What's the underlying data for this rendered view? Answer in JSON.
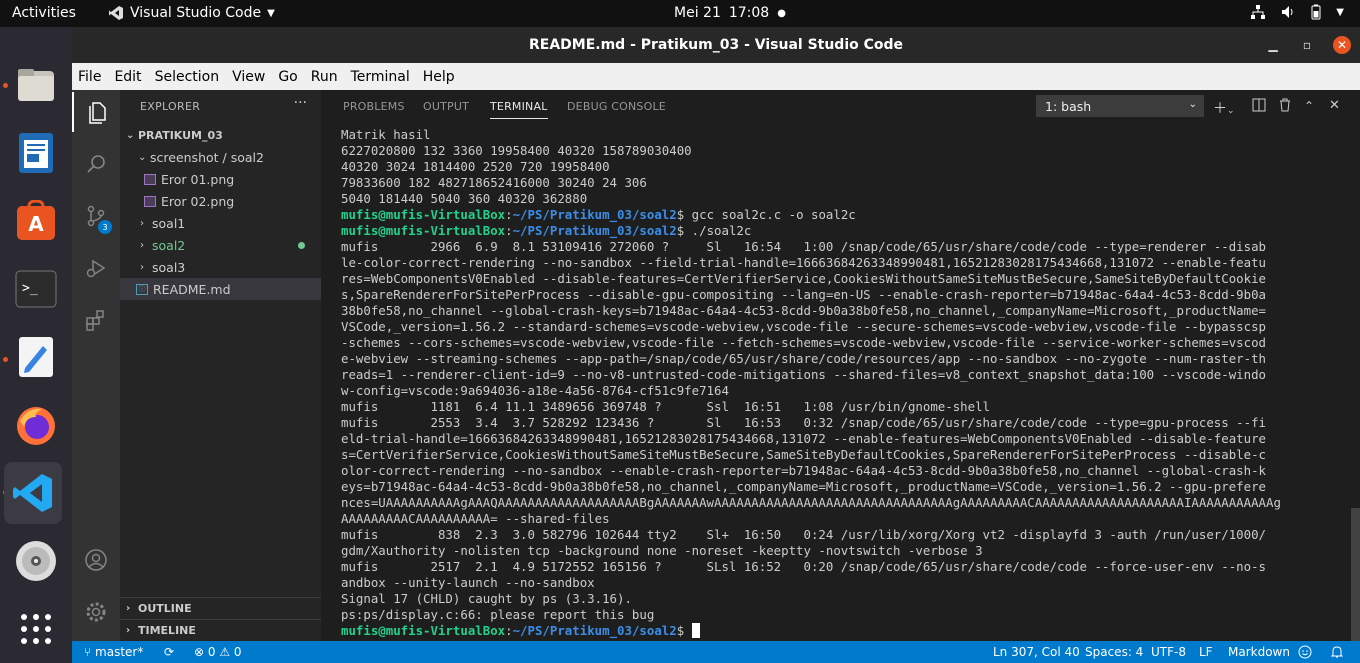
{
  "topbar": {
    "activities": "Activities",
    "app_name": "Visual Studio Code",
    "date": "Mei 21",
    "time": "17:08"
  },
  "window": {
    "title": "README.md - Pratikum_03 - Visual Studio Code"
  },
  "menu": [
    "File",
    "Edit",
    "Selection",
    "View",
    "Go",
    "Run",
    "Terminal",
    "Help"
  ],
  "activity_badges": {
    "scm": "3"
  },
  "explorer": {
    "header": "EXPLORER",
    "more": "···",
    "root": "PRATIKUM_03",
    "folder_screenshot": "screenshot / soal2",
    "file1": "Eror 01.png",
    "file2": "Eror 02.png",
    "folder_soal1": "soal1",
    "folder_soal2": "soal2",
    "folder_soal3": "soal3",
    "readme": "README.md",
    "outline": "OUTLINE",
    "timeline": "TIMELINE"
  },
  "panel": {
    "tabs": [
      "PROBLEMS",
      "OUTPUT",
      "TERMINAL",
      "DEBUG CONSOLE"
    ],
    "terminal_select": "1: bash"
  },
  "terminal": {
    "lines": [
      "Matrik hasil",
      "6227020800 132 3360 19958400 40320 158789030400",
      "40320 3024 1814400 2520 720 19958400",
      "79833600 182 482718652416000 30240 24 306",
      "5040 181440 5040 360 40320 362880",
      {
        "user": "mufis@mufis-VirtualBox",
        "path": "~/PS/Pratikum_03/soal2",
        "cmd": " gcc soal2c.c -o soal2c"
      },
      {
        "user": "mufis@mufis-VirtualBox",
        "path": "~/PS/Pratikum_03/soal2",
        "cmd": " ./soal2c"
      },
      "mufis       2966  6.9  8.1 53109416 272060 ?     Sl   16:54   1:00 /snap/code/65/usr/share/code/code --type=renderer --disab",
      "le-color-correct-rendering --no-sandbox --field-trial-handle=16663684263348990481,16521283028175434668,131072 --enable-featu",
      "res=WebComponentsV0Enabled --disable-features=CertVerifierService,CookiesWithoutSameSiteMustBeSecure,SameSiteByDefaultCookie",
      "s,SpareRendererForSitePerProcess --disable-gpu-compositing --lang=en-US --enable-crash-reporter=b71948ac-64a4-4c53-8cdd-9b0a",
      "38b0fe58,no_channel --global-crash-keys=b71948ac-64a4-4c53-8cdd-9b0a38b0fe58,no_channel,_companyName=Microsoft,_productName=",
      "VSCode,_version=1.56.2 --standard-schemes=vscode-webview,vscode-file --secure-schemes=vscode-webview,vscode-file --bypasscsp",
      "-schemes --cors-schemes=vscode-webview,vscode-file --fetch-schemes=vscode-webview,vscode-file --service-worker-schemes=vscod",
      "e-webview --streaming-schemes --app-path=/snap/code/65/usr/share/code/resources/app --no-sandbox --no-zygote --num-raster-th",
      "reads=1 --renderer-client-id=9 --no-v8-untrusted-code-mitigations --shared-files=v8_context_snapshot_data:100 --vscode-windo",
      "w-config=vscode:9a694036-a18e-4a56-8764-cf51c9fe7164",
      "mufis       1181  6.4 11.1 3489656 369748 ?      Ssl  16:51   1:08 /usr/bin/gnome-shell",
      "mufis       2553  3.4  3.7 528292 123436 ?       Sl   16:53   0:32 /snap/code/65/usr/share/code/code --type=gpu-process --fi",
      "eld-trial-handle=16663684263348990481,16521283028175434668,131072 --enable-features=WebComponentsV0Enabled --disable-feature",
      "s=CertVerifierService,CookiesWithoutSameSiteMustBeSecure,SameSiteByDefaultCookies,SpareRendererForSitePerProcess --disable-c",
      "olor-correct-rendering --no-sandbox --enable-crash-reporter=b71948ac-64a4-4c53-8cdd-9b0a38b0fe58,no_channel --global-crash-k",
      "eys=b71948ac-64a4-4c53-8cdd-9b0a38b0fe58,no_channel,_companyName=Microsoft,_productName=VSCode,_version=1.56.2 --gpu-prefere",
      "nces=UAAAAAAAAAAgAAAQAAAAAAAAAAAAAAAAAAABgAAAAAAAwAAAAAAAAAAAAAAAAAAAAAAAAAAAAAAAAgAAAAAAAAACAAAAAAAAAAAAAAAAAAAAIAAAAAAAAAAAg",
      "AAAAAAAAACAAAAAAAAAA= --shared-files",
      "mufis        838  2.3  3.0 582796 102644 tty2    Sl+  16:50   0:24 /usr/lib/xorg/Xorg vt2 -displayfd 3 -auth /run/user/1000/",
      "gdm/Xauthority -nolisten tcp -background none -noreset -keeptty -novtswitch -verbose 3",
      "mufis       2517  2.1  4.9 5172552 165156 ?      SLsl 16:52   0:20 /snap/code/65/usr/share/code/code --force-user-env --no-s",
      "andbox --unity-launch --no-sandbox",
      "Signal 17 (CHLD) caught by ps (3.3.16).",
      "ps:ps/display.c:66: please report this bug",
      {
        "user": "mufis@mufis-VirtualBox",
        "path": "~/PS/Pratikum_03/soal2",
        "cmd": " ",
        "cursor": true
      }
    ]
  },
  "status": {
    "branch": "master*",
    "sync": "⟳",
    "problems": "⊗ 0 ⚠ 0",
    "position": "Ln 307, Col 40",
    "spaces": "Spaces: 4",
    "encoding": "UTF-8",
    "eol": "LF",
    "language": "Markdown"
  }
}
